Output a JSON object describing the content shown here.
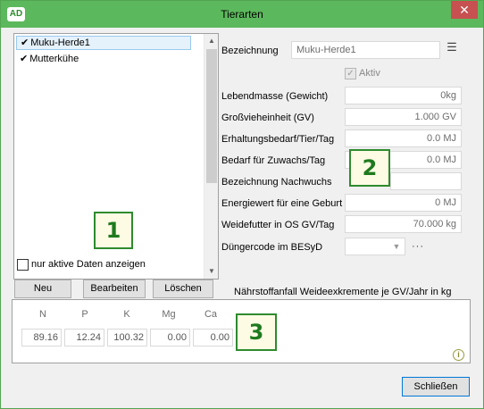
{
  "window": {
    "title": "Tierarten",
    "app_icon": "AD",
    "close_symbol": "✕"
  },
  "list": {
    "items": [
      {
        "label": "Muku-Herde1",
        "checked": true
      },
      {
        "label": "Mutterkühe",
        "checked": true
      }
    ],
    "checkmark": "✔"
  },
  "filter": {
    "label": "nur aktive Daten anzeigen",
    "checked": false
  },
  "buttons": {
    "new": "Neu",
    "edit": "Bearbeiten",
    "delete": "Löschen",
    "close": "Schließen"
  },
  "form": {
    "bezeichnung_label": "Bezeichnung",
    "bezeichnung_value": "Muku-Herde1",
    "aktiv_label": "Aktiv",
    "aktiv_checked": true,
    "lebendmasse_label": "Lebendmasse (Gewicht)",
    "lebendmasse_value": "0kg",
    "gv_label": "Großvieheinheit (GV)",
    "gv_value": "1.000 GV",
    "erhaltung_label": "Erhaltungsbedarf/Tier/Tag",
    "erhaltung_value": "0.0 MJ",
    "zuwachs_label": "Bedarf für Zuwachs/Tag",
    "zuwachs_value": "0.0 MJ",
    "nachwuchs_label": "Bezeichnung Nachwuchs",
    "nachwuchs_value": "",
    "geburt_label": "Energiewert für eine Geburt",
    "geburt_value": "0 MJ",
    "weidefutter_label": "Weidefutter in OS GV/Tag",
    "weidefutter_value": "70.000 kg",
    "duenger_label": "Düngercode im BESyD",
    "duenger_value": "",
    "more": "···"
  },
  "nutrients": {
    "title": "Nährstoffanfall Weideexkremente je GV/Jahr in kg",
    "headers": [
      "N",
      "P",
      "K",
      "Mg",
      "Ca"
    ],
    "values": [
      "89.16",
      "12.24",
      "100.32",
      "0.00",
      "0.00"
    ],
    "info_symbol": "i"
  },
  "annotations": [
    "1",
    "2",
    "3"
  ],
  "colors": {
    "titlebar": "#5cb85c",
    "annotation_border": "#2e8b2e",
    "annotation_fill": "#fdfbe3",
    "close_button": "#c75050"
  }
}
